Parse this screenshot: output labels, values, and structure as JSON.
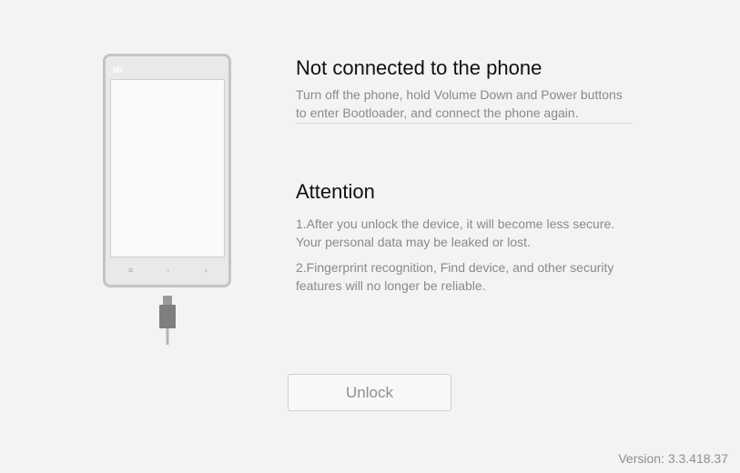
{
  "phone": {
    "logo": "MI",
    "nav_icons": [
      "menu-icon",
      "home-icon",
      "back-icon"
    ],
    "nav_glyphs": {
      "menu": "≡",
      "home": "▫",
      "back": "‹"
    }
  },
  "status": {
    "title": "Not connected to the phone",
    "text": "Turn off the phone, hold Volume Down and Power buttons to enter Bootloader, and connect the phone again."
  },
  "attention": {
    "title": "Attention",
    "items": [
      "1.After you unlock the device, it will become less secure. Your personal data may be leaked or lost.",
      "2.Fingerprint recognition, Find device, and other security features will no longer be reliable."
    ]
  },
  "actions": {
    "unlock_label": "Unlock"
  },
  "footer": {
    "version": "Version: 3.3.418.37"
  },
  "colors": {
    "background": "#f3f3f3",
    "title_text": "#111111",
    "body_text": "#8a8a8a",
    "button_text": "#8e8e8e",
    "phone_frame": "#c4c4c4"
  }
}
